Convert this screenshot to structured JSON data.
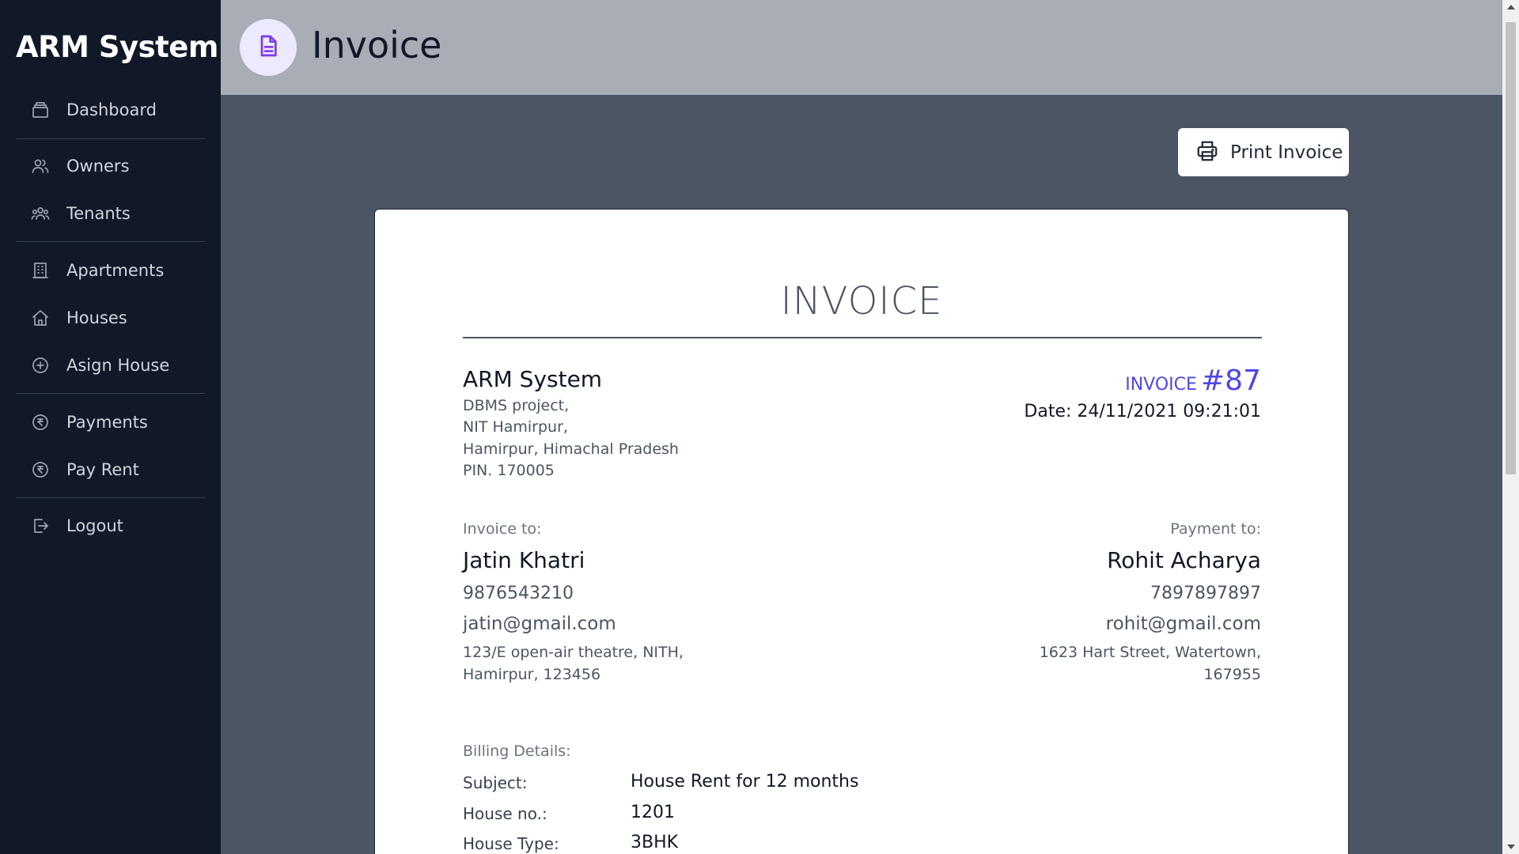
{
  "sidebar": {
    "brand": "ARM System",
    "items": [
      {
        "label": "Dashboard",
        "icon": "archive-icon"
      },
      {
        "label": "Owners",
        "icon": "users-icon"
      },
      {
        "label": "Tenants",
        "icon": "user-group-icon"
      },
      {
        "label": "Apartments",
        "icon": "office-building-icon"
      },
      {
        "label": "Houses",
        "icon": "home-icon"
      },
      {
        "label": "Asign House",
        "icon": "plus-circle-icon"
      },
      {
        "label": "Payments",
        "icon": "rupee-circle-icon"
      },
      {
        "label": "Pay Rent",
        "icon": "rupee-circle-icon"
      },
      {
        "label": "Logout",
        "icon": "logout-icon"
      }
    ]
  },
  "header": {
    "title": "Invoice",
    "icon": "document-text-icon"
  },
  "toolbar": {
    "print_label": "Print Invoice",
    "print_icon": "printer-icon"
  },
  "invoice": {
    "heading": "INVOICE",
    "company": {
      "name": "ARM System",
      "lines": [
        "DBMS project,",
        "NIT Hamirpur,",
        "Hamirpur, Himachal Pradesh",
        "PIN. 170005"
      ]
    },
    "number_label": "INVOICE",
    "number": "#87",
    "date": "Date: 24/11/2021 09:21:01",
    "invoice_to": {
      "caption": "Invoice to:",
      "name": "Jatin Khatri",
      "phone": "9876543210",
      "email": "jatin@gmail.com",
      "address": [
        "123/E open-air theatre, NITH,",
        "Hamirpur, 123456"
      ]
    },
    "payment_to": {
      "caption": "Payment to:",
      "name": "Rohit Acharya",
      "phone": "7897897897",
      "email": "rohit@gmail.com",
      "address": [
        "1623 Hart Street, Watertown,",
        "167955"
      ]
    },
    "billing": {
      "caption": "Billing Details:",
      "rows": [
        {
          "key": "Subject:",
          "value": "House Rent for 12 months"
        },
        {
          "key": "House no.:",
          "value": "1201"
        },
        {
          "key": "House Type:",
          "value": "3BHK"
        }
      ]
    }
  },
  "colors": {
    "sidebar_bg": "#111827",
    "header_bg": "#a8adb6",
    "content_bg": "#4b5563",
    "accent": "#4f46e5",
    "badge_bg": "#ede9fe"
  }
}
